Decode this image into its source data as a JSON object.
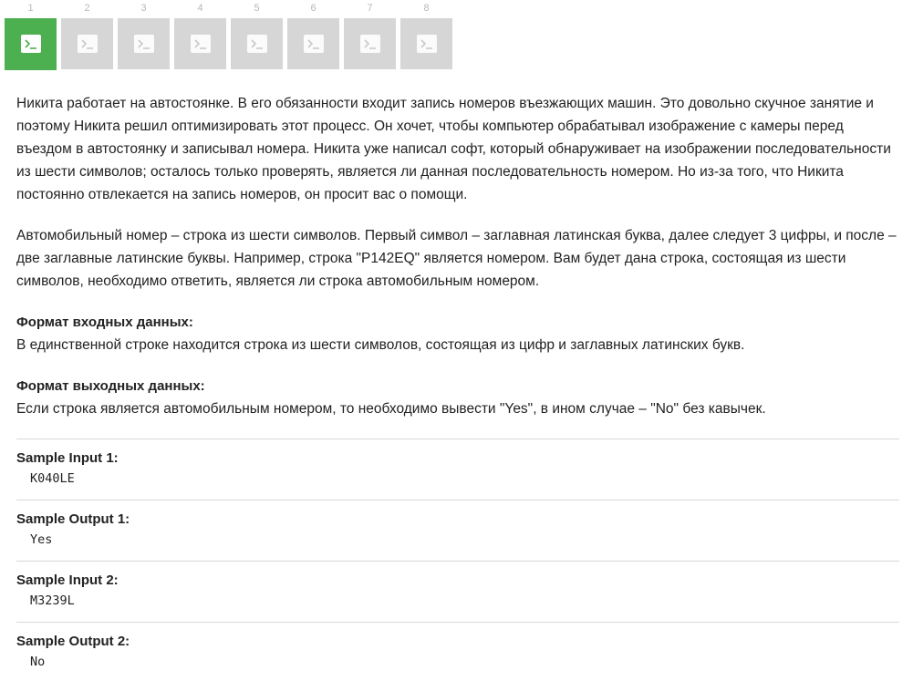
{
  "tabs": [
    {
      "number": "1",
      "icon": "terminal-icon",
      "active": true
    },
    {
      "number": "2",
      "icon": "terminal-icon",
      "active": false
    },
    {
      "number": "3",
      "icon": "terminal-icon",
      "active": false
    },
    {
      "number": "4",
      "icon": "terminal-icon",
      "active": false
    },
    {
      "number": "5",
      "icon": "terminal-icon",
      "active": false
    },
    {
      "number": "6",
      "icon": "terminal-icon",
      "active": false
    },
    {
      "number": "7",
      "icon": "terminal-icon",
      "active": false
    },
    {
      "number": "8",
      "icon": "terminal-icon",
      "active": false
    }
  ],
  "colors": {
    "active_tab": "#4caf50",
    "inactive_tab": "#d6d6d6"
  },
  "statement": {
    "paragraphs": [
      "Никита работает на автостоянке. В его обязанности входит запись номеров въезжающих машин. Это довольно скучное занятие и поэтому Никита решил оптимизировать этот процесс. Он хочет, чтобы компьютер обрабатывал изображение с камеры перед въездом в автостоянку и записывал номера. Никита уже написал софт, который обнаруживает на изображении последовательности из шести символов; осталось только проверять, является ли данная последовательность номером. Но из-за того, что Никита постоянно отвлекается на запись номеров, он просит вас о помощи.",
      "Автомобильный номер – строка из шести символов. Первый символ – заглавная латинская буква, далее следует 3 цифры, и после – две заглавные латинские буквы. Например, строка \"P142EQ\" является номером. Вам будет дана строка, состоящая из шести символов, необходимо ответить, является ли строка автомобильным номером."
    ],
    "input_format_title": "Формат входных данных:",
    "input_format_text": "В единственной строке находится строка из шести символов, состоящая из цифр и заглавных латинских букв.",
    "output_format_title": "Формат выходных данных:",
    "output_format_text": "Если строка является автомобильным номером, то необходимо вывести \"Yes\", в ином случае – \"No\" без кавычек."
  },
  "samples": [
    {
      "title": "Sample Input 1:",
      "value": "K040LE"
    },
    {
      "title": "Sample Output 1:",
      "value": "Yes"
    },
    {
      "title": "Sample Input 2:",
      "value": "M3239L"
    },
    {
      "title": "Sample Output 2:",
      "value": "No"
    }
  ]
}
